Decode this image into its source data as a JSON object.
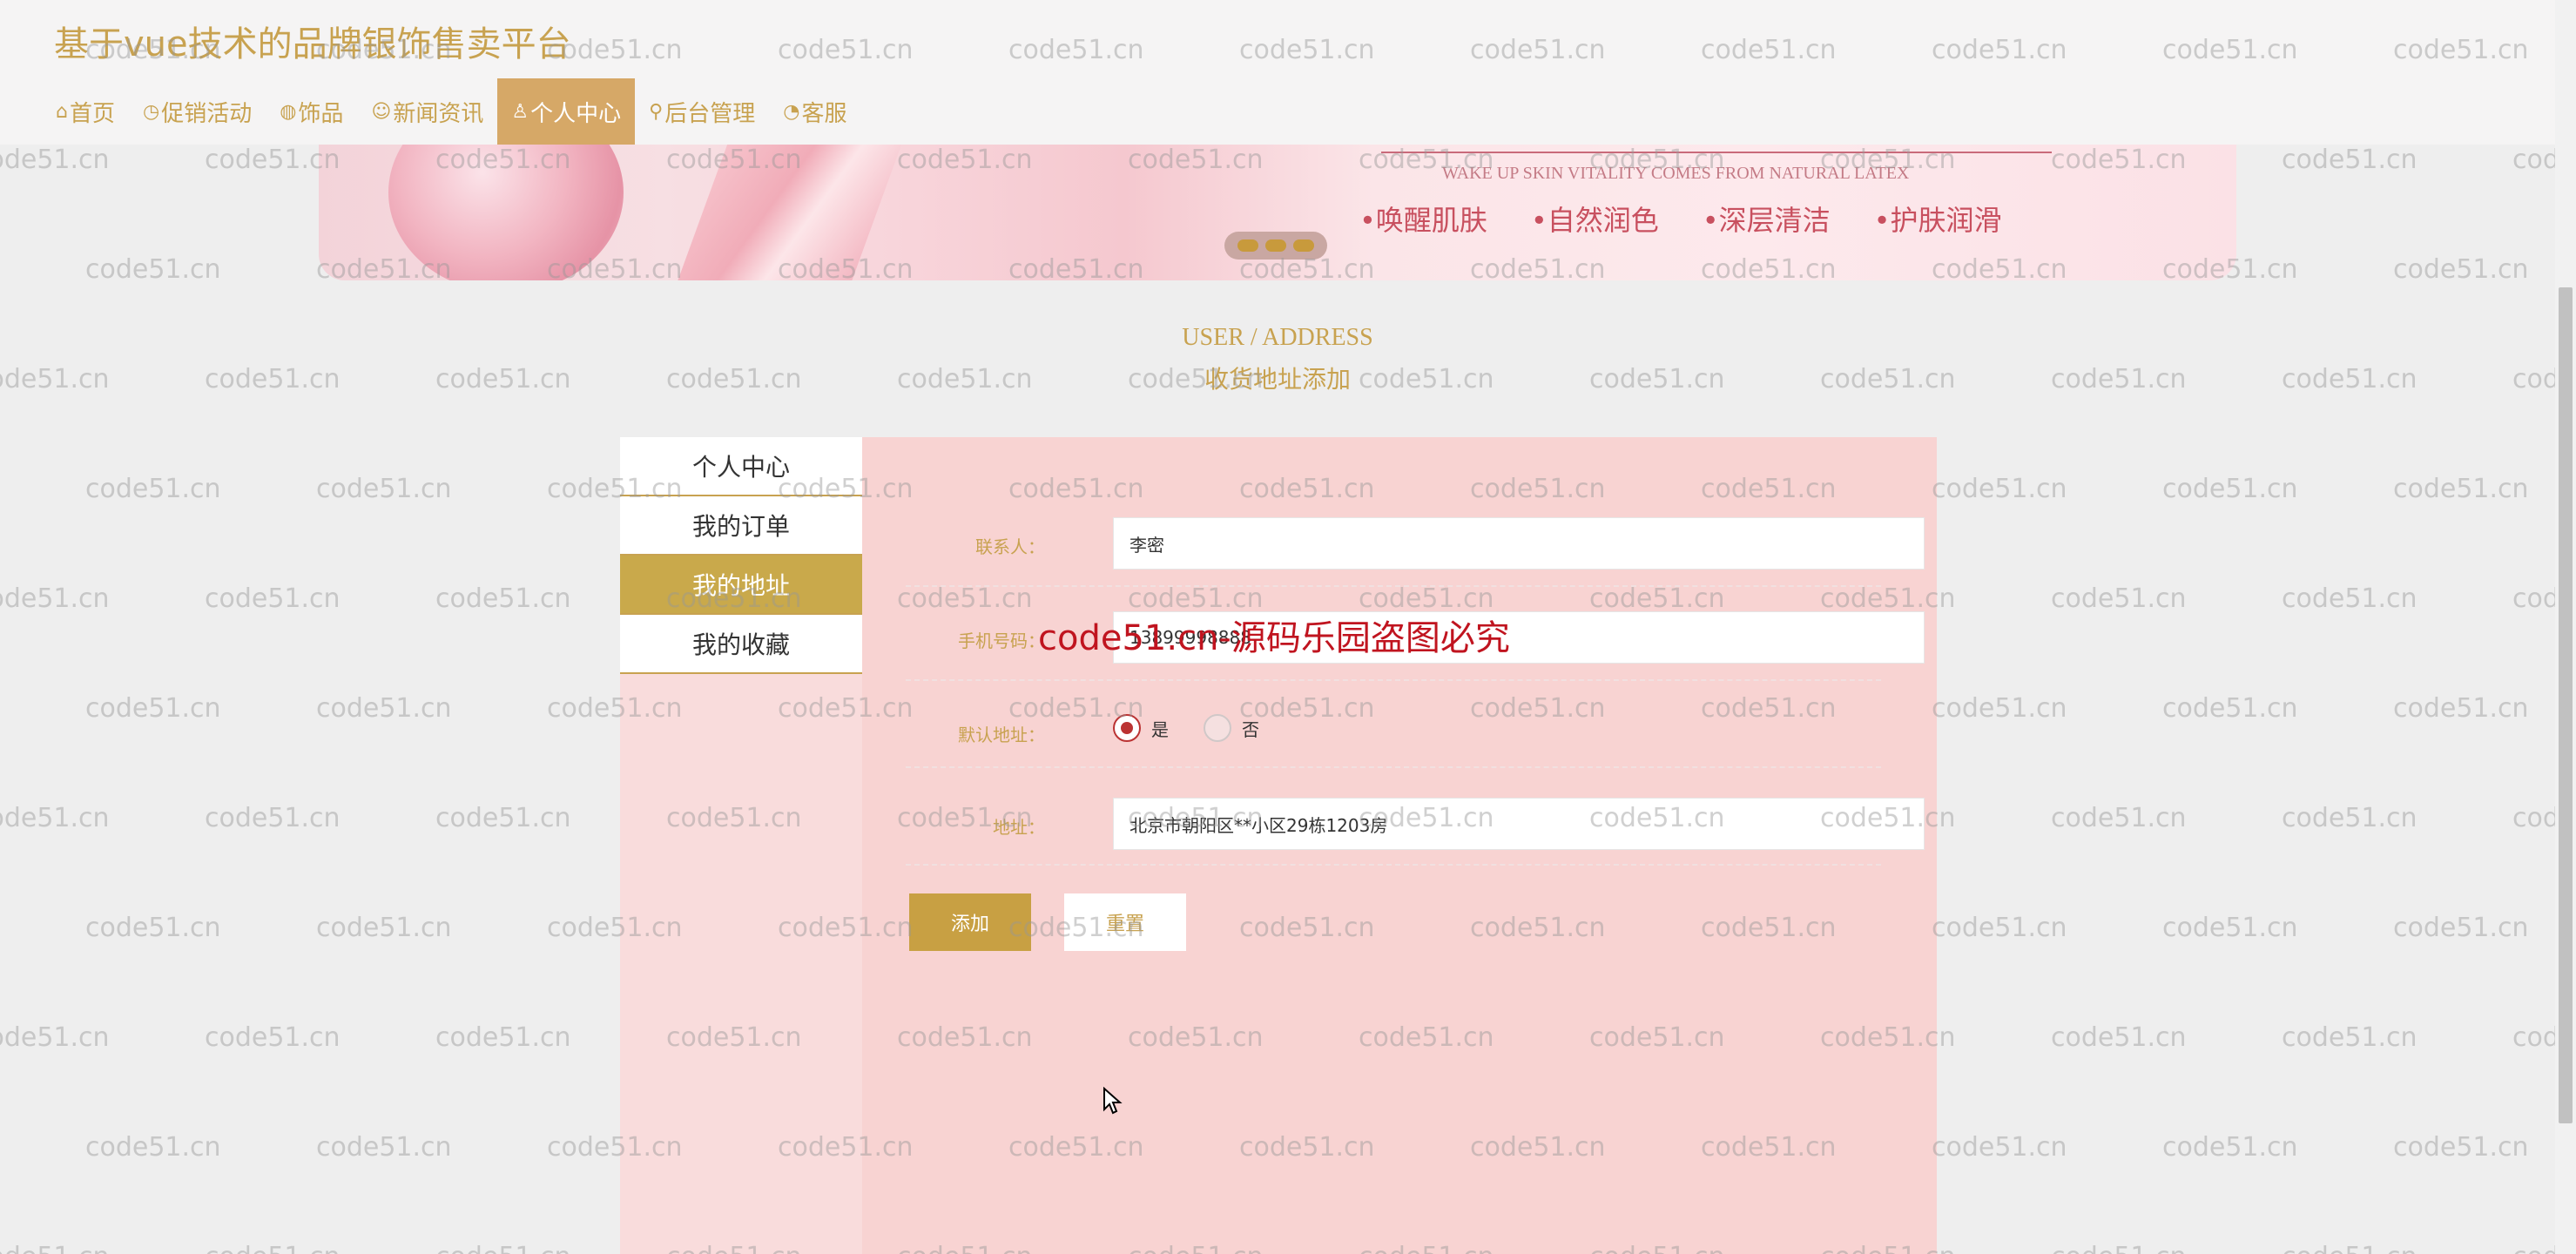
{
  "header": {
    "title": "基于vue技术的品牌银饰售卖平台",
    "nav": [
      {
        "icon": "home-icon",
        "glyph": "⌂",
        "label": "首页"
      },
      {
        "icon": "clock-icon",
        "glyph": "◷",
        "label": "促销活动"
      },
      {
        "icon": "globe-icon",
        "glyph": "◍",
        "label": "饰品"
      },
      {
        "icon": "smile-icon",
        "glyph": "☺",
        "label": "新闻资讯"
      },
      {
        "icon": "user-icon",
        "glyph": "♙",
        "label": "个人中心"
      },
      {
        "icon": "link-icon",
        "glyph": "⚲",
        "label": "后台管理"
      },
      {
        "icon": "chat-icon",
        "glyph": "◔",
        "label": "客服"
      }
    ],
    "active_nav": "个人中心"
  },
  "banner": {
    "tagline": "WAKE UP SKIN VITALITY COMES FROM NATURAL LATEX",
    "features": [
      "•唤醒肌肤",
      "•自然润色",
      "•深层清洁",
      "•护肤润滑"
    ]
  },
  "section": {
    "title_en": "USER / ADDRESS",
    "title_cn": "收货地址添加"
  },
  "sidebar": {
    "items": [
      "个人中心",
      "我的订单",
      "我的地址",
      "我的收藏"
    ],
    "active": "我的地址"
  },
  "form": {
    "contact_label": "联系人：",
    "contact_value": "李密",
    "phone_label": "手机号码：",
    "phone_value": "13899998888",
    "default_label": "默认地址：",
    "default_options": [
      "是",
      "否"
    ],
    "default_selected": "是",
    "address_label": "地址：",
    "address_value": "北京市朝阳区**小区29栋1203房",
    "add_button": "添加",
    "reset_button": "重置"
  },
  "overlay": {
    "text": "code51.cn-源码乐园盗图必究"
  },
  "watermark": {
    "text": "code51.cn"
  },
  "colors": {
    "brand_gold": "#c8a250",
    "nav_active": "#d6a867",
    "sidebar_active": "#c9a94b",
    "panel_bg": "#f8d3d2",
    "overlay_red": "#c0141f"
  }
}
